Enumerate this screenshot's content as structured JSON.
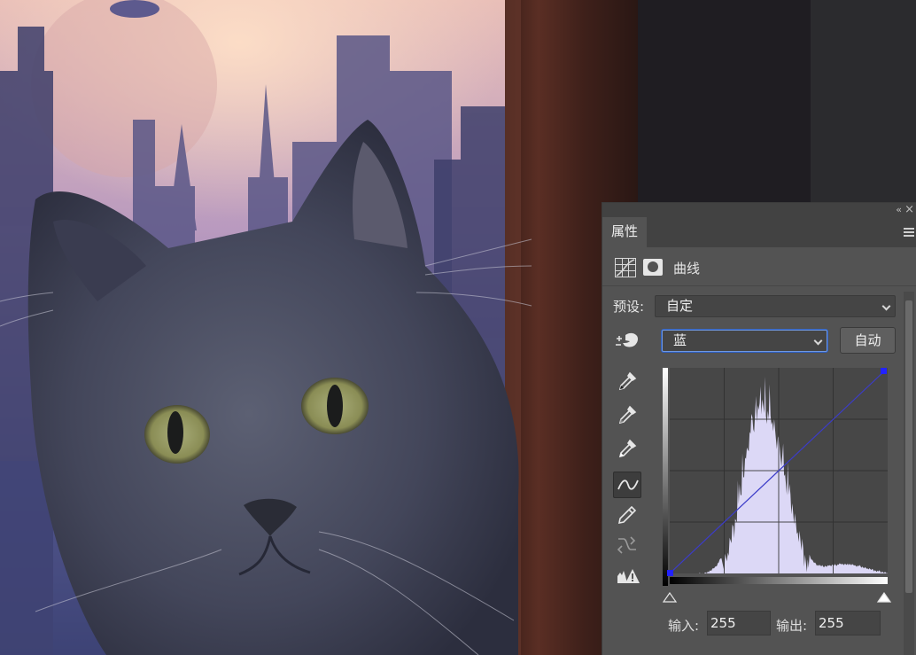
{
  "panel": {
    "tab_label": "属性",
    "adjustment_title": "曲线",
    "preset_label": "预设:",
    "preset_value": "自定",
    "channel_value": "蓝",
    "auto_label": "自动",
    "input_label": "输入:",
    "input_value": "255",
    "output_label": "输出:",
    "output_value": "255"
  },
  "icons": {
    "collapse": "double-chevron-icon",
    "close": "close-icon",
    "menu": "panel-menu-icon",
    "adjustment": "curves-adjustment-icon",
    "mask": "layer-mask-icon",
    "hand": "on-image-adjust-icon",
    "tools": [
      "black-point-eyedropper-icon",
      "gray-point-eyedropper-icon",
      "white-point-eyedropper-icon",
      "point-curve-icon",
      "pencil-icon",
      "smooth-curve-icon",
      "clipping-warning-icon"
    ]
  },
  "colors": {
    "panel_bg": "#535353",
    "histogram_fill": "#dcd8f6",
    "curve_line": "#3c3cc8",
    "endpoint": "#2222ff",
    "focus_ring": "#2f5fbf"
  }
}
